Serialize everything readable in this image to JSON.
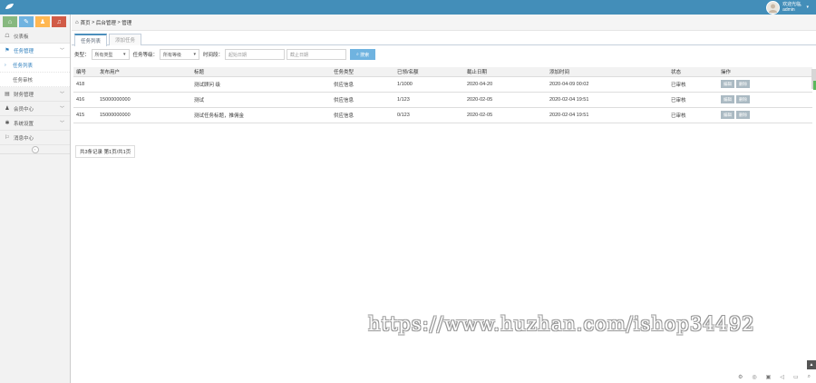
{
  "header": {
    "logo_icon": "leaf-icon",
    "user": {
      "greeting": "欢迎光临,",
      "name": "admin"
    },
    "colors": {
      "topbar": "#438eb9"
    }
  },
  "shortcuts": [
    {
      "icon": "home-icon",
      "glyph": "⌂",
      "color": "#87b87f"
    },
    {
      "icon": "pencil-icon",
      "glyph": "✎",
      "color": "#6fb3e0"
    },
    {
      "icon": "users-icon",
      "glyph": "♟",
      "color": "#ffb752"
    },
    {
      "icon": "bell-icon",
      "glyph": "♫",
      "color": "#d15b47"
    }
  ],
  "sidebar": {
    "items": [
      {
        "label": "仪表板",
        "icon": "dashboard-icon",
        "glyph": "☖"
      },
      {
        "label": "任务管理",
        "icon": "flag-icon",
        "glyph": "⚑",
        "arrow": "﹀"
      },
      {
        "label": "财务管理",
        "icon": "list-icon",
        "glyph": "▤",
        "arrow": "﹀"
      },
      {
        "label": "会员中心",
        "icon": "user-icon",
        "glyph": "♟",
        "arrow": "﹀"
      },
      {
        "label": "系统设置",
        "icon": "gear-icon",
        "glyph": "✱",
        "arrow": "﹀"
      },
      {
        "label": "消息中心",
        "icon": "bookmark-icon",
        "glyph": "⚐"
      }
    ],
    "subitems": [
      {
        "label": "任务列表",
        "mark": "›"
      },
      {
        "label": "任务审核"
      }
    ],
    "collapse_glyph": "«"
  },
  "breadcrumb": {
    "home": "首页",
    "sep": ">",
    "section": "后台管理",
    "page": "管理"
  },
  "tabs": [
    {
      "label": "任务列表"
    },
    {
      "label": "添加任务"
    }
  ],
  "filters": {
    "type_label": "类型：",
    "type_value": "所有类型",
    "level_label": "任务等级：",
    "level_value": "所有等级",
    "time_label": "时间段：",
    "start_placeholder": "起始日期",
    "end_placeholder": "截止日期",
    "search_label": "搜索"
  },
  "table": {
    "headers": [
      "编号",
      "发布用户",
      "标题",
      "任务类型",
      "已领/名额",
      "截止日期",
      "添加时间",
      "状态",
      "操作"
    ],
    "rows": [
      [
        "418",
        "",
        "测试顾问 级",
        "供应信息",
        "1/1000",
        "2020-04-20",
        "2020-04-09 00:02",
        "已审核"
      ],
      [
        "416",
        "15000000000",
        "测试",
        "供应信息",
        "1/123",
        "2020-02-05",
        "2020-02-04 19:51",
        "已审核"
      ],
      [
        "415",
        "15000000000",
        "测试任务标题，推佣金",
        "供应信息",
        "0/123",
        "2020-02-05",
        "2020-02-04 19:51",
        "已审核"
      ]
    ],
    "actions": {
      "edit": "编辑",
      "delete": "删除"
    }
  },
  "pager": {
    "text": "共3条记录 第1页/共1页"
  },
  "watermark": "https://www.huzhan.com/ishop34492"
}
